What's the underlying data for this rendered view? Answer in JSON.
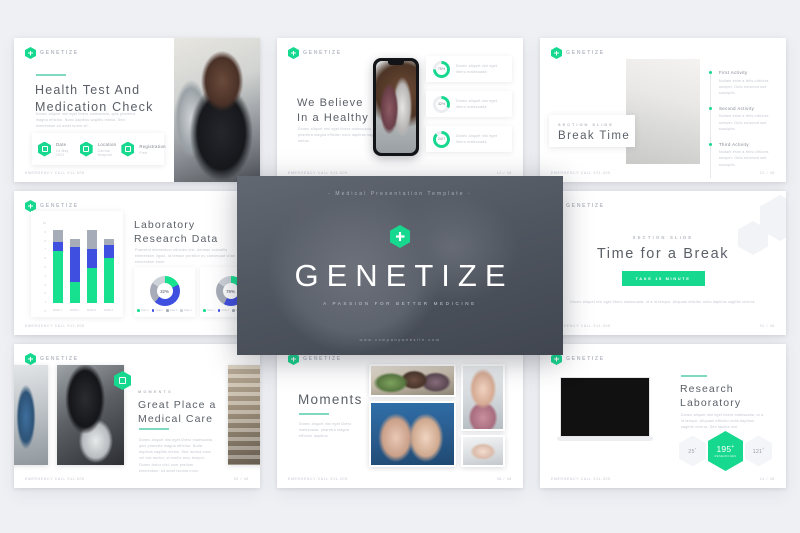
{
  "brand": {
    "name": "GENETIZE",
    "logo_icon": "hexagon-medical-cross-icon"
  },
  "background_color": "#eff0f4",
  "accent_color": "#17d88f",
  "cover": {
    "eyebrow": "- Medical Presentation Template -",
    "logo_icon": "hexagon-medical-cross-icon",
    "title": "GENETIZE",
    "subtitle": "A PASSION FOR BETTER MEDICINE",
    "url": "www.companywebsite.com",
    "background_color": "#3d424e"
  },
  "slides": [
    {
      "id": "health-test",
      "position": "top-left",
      "rule": true,
      "title": "Health Test And\nMedication Check",
      "body": "Donec aliquet nisi eget libero malesuada, quis pharetra magna efficitur. Nunc dapibus sagittis metus. Sed elementum sit amet lorem sit.",
      "facts": [
        {
          "icon": "calendar-icon",
          "label": "Date",
          "value": "14 May 2021"
        },
        {
          "icon": "location-icon",
          "label": "Location",
          "value": "Central Hospital"
        },
        {
          "icon": "registration-icon",
          "label": "Registration",
          "value": "Free"
        }
      ],
      "footer_left": "EMERGENCY CALL 911-005",
      "footer_right": "01 / 46",
      "photo": "nurse-taking-blood-pressure"
    },
    {
      "id": "we-believe",
      "position": "top-middle",
      "title": "We Believe\nIn a Healthy",
      "body": "Donec aliquet nisi eget libero malesuada, quis pharetra magna efficitur nunc dapibus sagittis metus.",
      "device": "smartphone-mockup",
      "device_photo": "pharmacist-with-patient",
      "stats": [
        {
          "value": "75%",
          "percent": 75,
          "body": "Donec aliquet nisi eget libero malesuada"
        },
        {
          "value": "32%",
          "percent": 32,
          "body": "Donec aliquet nisi eget libero malesuada"
        },
        {
          "value": "24/7",
          "percent": 88,
          "body": "Donec aliquet nisi eget libero malesuada"
        }
      ],
      "footer_left": "EMERGENCY CALL 911-005",
      "footer_right": "12 / 46"
    },
    {
      "id": "break-time",
      "position": "top-right",
      "eyebrow": "SECTION SLIDE",
      "title": "Break Time",
      "photo": "hospital-waiting-room",
      "timeline": [
        {
          "heading": "First Activity",
          "body": "Nullam enim a felis ultricies semper. Odio euismod sed suscipits."
        },
        {
          "heading": "Second Activity",
          "body": "Nullam enim a felis ultricies semper. Odio euismod sed suscipits."
        },
        {
          "heading": "Third Activity",
          "body": "Nullam enim a felis ultricies semper. Odio euismod sed suscipits."
        }
      ],
      "footer_left": "EMERGENCY CALL 911-005",
      "footer_right": "21 / 46"
    },
    {
      "id": "laboratory-research-data",
      "position": "middle-left",
      "title": "Laboratory\nResearch Data",
      "body": "Praesent elementum ultricies nisl. Aenean convallis elementum ligula, id tempor porttitor eu consequat vitae, elementum enim.",
      "footer_left": "EMERGENCY CALL 911-005",
      "footer_right": "24 / 46"
    },
    {
      "id": "center-cover-placeholder",
      "position": "middle-middle",
      "hidden_behind_cover": true
    },
    {
      "id": "time-for-a-break",
      "position": "middle-right",
      "eyebrow": "SECTION SLIDE",
      "title": "Time for a Break",
      "button": "TAKE 15 MINUTE",
      "body": "Donec aliquet nisi eget libero malesuada, ut a id tempor. Aliquam efficitur nulla dapibus sagittis viverra.",
      "footer_left": "EMERGENCY CALL 911-005",
      "footer_right": "31 / 46"
    },
    {
      "id": "great-place",
      "position": "bottom-left",
      "eyebrow": "MOMENTS",
      "title": "Great Place a\nMedical Care",
      "body": "Donec aliquet nisi eget libero malesuada, quis pharetra magna efficitur. Nulla dapibus sagittis metus. Sed lacinia nunc vel nisi auctor, ut mollis arcu tempor. Donec tortor nisl, cum pretium elementum, sit amet lacinia nunc.",
      "badge_icon": "hexagon-medical-cross-icon",
      "photos": [
        "hospital-corridor",
        "microscope-gloved-hand",
        "medical-shelf"
      ],
      "footer_left": "EMERGENCY CALL 911-005",
      "footer_right": "35 / 46"
    },
    {
      "id": "moments",
      "position": "bottom-middle",
      "title": "Moments",
      "body": "Donec aliquet nisi eget libero malesuada, pharetra magna efficitur dapibus.",
      "photos": [
        "family-visiting",
        "child-patient-with-teddy",
        "children-playing-in-ward",
        "holding-hands"
      ],
      "footer_left": "EMERGENCY CALL 911-005",
      "footer_right": "38 / 46"
    },
    {
      "id": "research-laboratory",
      "position": "bottom-right",
      "title": "Research\nLaboratory",
      "body": "Donec aliquet nisi eget libero malesuada, ut a id tempor. Aliquam efficitur nulla dapibus sagittis viverra. Sed lacinia nisi.",
      "photo": "scientist-in-laboratory",
      "device": "laptop-mockup",
      "stats": [
        {
          "value": "25",
          "suffix": "+",
          "caption": "",
          "highlight": false
        },
        {
          "value": "195",
          "suffix": "+",
          "caption": "RESEARCHES",
          "highlight": true
        },
        {
          "value": "121",
          "suffix": "+",
          "caption": "",
          "highlight": false
        }
      ],
      "footer_left": "EMERGENCY CALL 911-005",
      "footer_right": "41 / 46"
    }
  ],
  "chart_data": [
    {
      "type": "bar",
      "stacked": true,
      "title": "Laboratory Research Data",
      "categories": [
        "DATA 1",
        "DATA 2",
        "DATA 3",
        "DATA 4"
      ],
      "series": [
        {
          "name": "Data 1",
          "color": "#17e08f",
          "values": [
            6.1,
            2.4,
            4.1,
            5.2
          ]
        },
        {
          "name": "Data 2",
          "color": "#3f4fe0",
          "values": [
            1.0,
            4.1,
            2.2,
            1.5
          ]
        },
        {
          "name": "Data 3",
          "color": "#a7adb8",
          "values": [
            1.4,
            1.0,
            2.2,
            0.8
          ]
        }
      ],
      "ylim": [
        0,
        10
      ],
      "yticks": [
        0,
        1,
        2,
        3,
        4,
        5,
        6,
        7,
        8,
        9,
        10
      ],
      "xlabel": "",
      "ylabel": "",
      "grid": false,
      "legend": "none"
    },
    {
      "type": "pie",
      "donut": true,
      "title": "",
      "center_label": "32%",
      "labels": [
        "Data 1",
        "Data 2",
        "Data 3",
        "Data 4"
      ],
      "values": [
        18,
        44,
        22,
        16
      ],
      "colors": [
        "#17e08f",
        "#3f4fe0",
        "#a7adb8",
        "#cdd1d8"
      ],
      "legend": "bottom"
    },
    {
      "type": "pie",
      "donut": true,
      "title": "",
      "center_label": "75%",
      "labels": [
        "Data 1",
        "Data 2",
        "Data 3",
        "Data 4"
      ],
      "values": [
        28,
        30,
        26,
        16
      ],
      "colors": [
        "#17e08f",
        "#3f4fe0",
        "#a7adb8",
        "#cdd1d8"
      ],
      "legend": "bottom"
    },
    {
      "type": "pie",
      "donut": true,
      "title": "We Believe In a Healthy",
      "center_label": "75%",
      "values": [
        75,
        25
      ],
      "colors": [
        "#17d88f",
        "#ebedf1"
      ],
      "legend": "none"
    },
    {
      "type": "pie",
      "donut": true,
      "center_label": "32%",
      "values": [
        32,
        68
      ],
      "colors": [
        "#17d88f",
        "#ebedf1"
      ],
      "legend": "none"
    },
    {
      "type": "pie",
      "donut": true,
      "center_label": "24/7",
      "values": [
        88,
        12
      ],
      "colors": [
        "#17d88f",
        "#ebedf1"
      ],
      "legend": "none"
    }
  ]
}
